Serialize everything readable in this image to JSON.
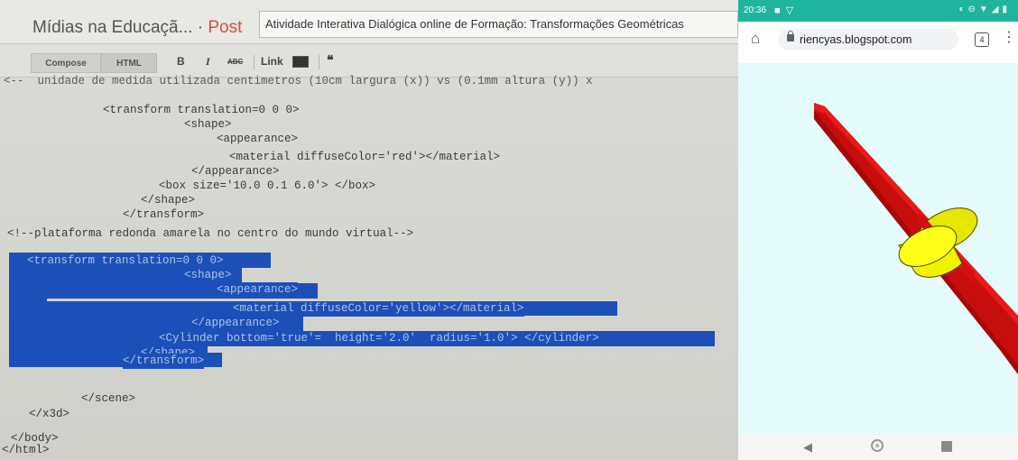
{
  "editor": {
    "blog_title": "Mídias na Educaçã...",
    "separator": " · ",
    "post_label": "Post",
    "post_title": "Atividade Interativa Dialógica online de Formação: Transformações Geométricas",
    "toolbar": {
      "compose": "Compose",
      "html": "HTML",
      "bold": "B",
      "italic": "I",
      "strike": "ABC",
      "link": "Link",
      "quote": "❝"
    },
    "code_lines": [
      "<--  unidade de medida utilizada centimetros (10cm largura (x)) vs (0.1mm altura (y)) x",
      "<transform translation=0 0 0>",
      "<shape>",
      "<appearance>",
      "<material diffuseColor='red'></material>",
      "</appearance>",
      "<box size='10.0 0.1 6.0'> </box>",
      "</shape>",
      "</transform>",
      "<!--plataforma redonda amarela no centro do mundo virtual-->",
      "<transform translation=0 0 0>",
      "<shape>",
      "<appearance>",
      "<material diffuseColor='yellow'></material>",
      "</appearance>",
      "<Cylinder bottom='true'=  height='2.0'  radius='1.0'> </cylinder>",
      "</shape>",
      "</transform>",
      "</scene>",
      "</x3d>",
      "</body>",
      "</html>"
    ]
  },
  "phone": {
    "status_time": "20:36",
    "url": "riencyas.blogspot.com",
    "tab_count": "4",
    "icons": [
      "home-icon",
      "lock-icon",
      "tabs-icon",
      "menu-icon",
      "back-icon",
      "home-nav-icon",
      "recent-apps-icon"
    ]
  },
  "colors": {
    "selection": "#1d4fb8",
    "status_bar": "#1fb59c",
    "box_red": "#d41010",
    "cylinder_yellow": "#f4f400",
    "viewport_bg": "#e6fbfc",
    "post_accent": "#dd4b39"
  }
}
